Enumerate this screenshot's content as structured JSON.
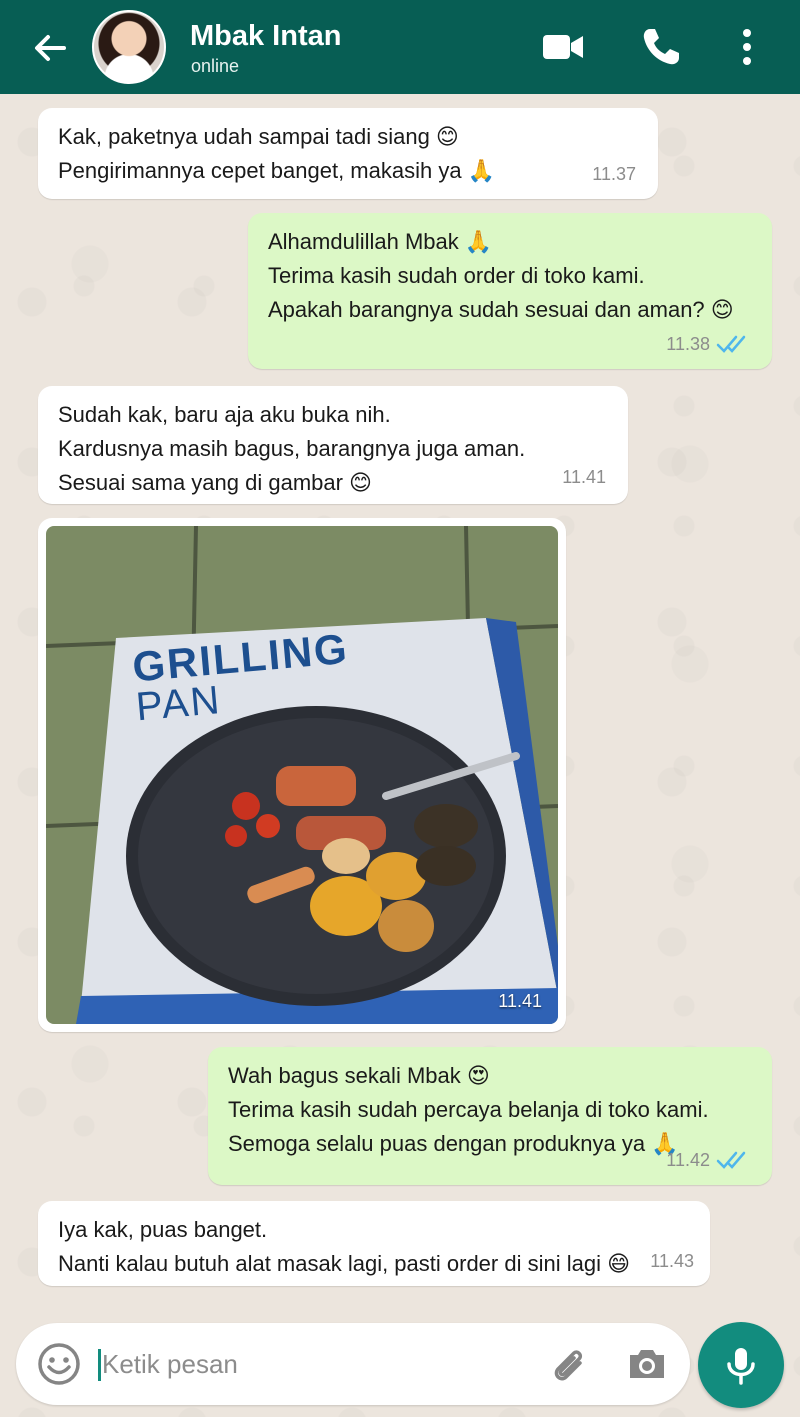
{
  "header": {
    "contact_name": "Mbak Intan",
    "status": "online",
    "color": "#075e54"
  },
  "messages": [
    {
      "direction": "in",
      "lines": [
        "Kak, paketnya udah sampai tadi siang 😊",
        "Pengirimannya cepet banget, makasih ya 🙏"
      ],
      "time": "11.37"
    },
    {
      "direction": "out",
      "lines": [
        "Alhamdulillah Mbak 🙏",
        "Terima kasih sudah order di toko kami.",
        "Apakah barangnya sudah sesuai dan aman? 😊"
      ],
      "time": "11.38",
      "read": true
    },
    {
      "direction": "in",
      "lines": [
        "Sudah kak, baru aja aku buka nih.",
        "Kardusnya masih bagus, barangnya juga aman.",
        "Sesuai sama yang di gambar 😊"
      ],
      "time": "11.41"
    },
    {
      "direction": "in",
      "type": "image",
      "image_text": [
        "GRILLING",
        "PAN"
      ],
      "time": "11.41"
    },
    {
      "direction": "out",
      "lines": [
        "Wah bagus sekali Mbak 😍",
        "Terima kasih sudah percaya belanja di toko kami.",
        "Semoga selalu puas dengan produknya ya 🙏"
      ],
      "time": "11.42",
      "read": true
    },
    {
      "direction": "in",
      "lines": [
        "Iya kak, puas banget.",
        "Nanti kalau butuh alat masak lagi, pasti order di sini lagi 😄"
      ],
      "time": "11.43"
    }
  ],
  "input": {
    "placeholder": "Ketik pesan"
  },
  "colors": {
    "incoming_bubble": "#ffffff",
    "outgoing_bubble": "#dcf8c6",
    "read_ticks": "#4fb6ec",
    "mic_button": "#128c7e"
  }
}
